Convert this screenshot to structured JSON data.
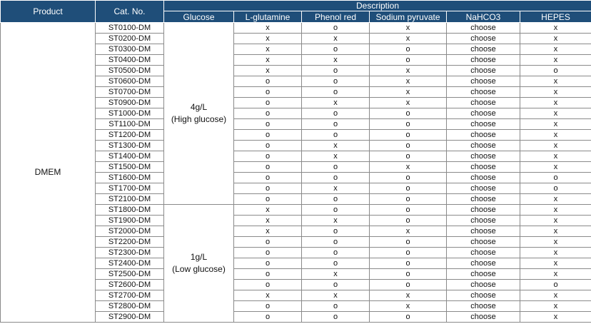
{
  "headers": {
    "product": "Product",
    "cat_no": "Cat. No.",
    "description": "Description",
    "columns": [
      "Glucose",
      "L-glutamine",
      "Phenol red",
      "Sodium pyruvate",
      "NaHCO3",
      "HEPES"
    ]
  },
  "product": "DMEM",
  "groups": [
    {
      "glucose_value": "4g/L",
      "glucose_note": "(High glucose)",
      "rows": [
        [
          "ST0100-DM",
          "x",
          "o",
          "x",
          "choose",
          "x"
        ],
        [
          "ST0200-DM",
          "x",
          "x",
          "x",
          "choose",
          "x"
        ],
        [
          "ST0300-DM",
          "x",
          "o",
          "o",
          "choose",
          "x"
        ],
        [
          "ST0400-DM",
          "x",
          "x",
          "o",
          "choose",
          "x"
        ],
        [
          "ST0500-DM",
          "x",
          "o",
          "x",
          "choose",
          "o"
        ],
        [
          "ST0600-DM",
          "o",
          "o",
          "x",
          "choose",
          "x"
        ],
        [
          "ST0700-DM",
          "o",
          "o",
          "x",
          "choose",
          "x"
        ],
        [
          "ST0900-DM",
          "o",
          "x",
          "x",
          "choose",
          "x"
        ],
        [
          "ST1000-DM",
          "o",
          "o",
          "o",
          "choose",
          "x"
        ],
        [
          "ST1100-DM",
          "o",
          "o",
          "o",
          "choose",
          "x"
        ],
        [
          "ST1200-DM",
          "o",
          "o",
          "o",
          "choose",
          "x"
        ],
        [
          "ST1300-DM",
          "o",
          "x",
          "o",
          "choose",
          "x"
        ],
        [
          "ST1400-DM",
          "o",
          "x",
          "o",
          "choose",
          "x"
        ],
        [
          "ST1500-DM",
          "o",
          "o",
          "x",
          "choose",
          "x"
        ],
        [
          "ST1600-DM",
          "o",
          "o",
          "o",
          "choose",
          "o"
        ],
        [
          "ST1700-DM",
          "o",
          "x",
          "o",
          "choose",
          "o"
        ],
        [
          "ST2100-DM",
          "o",
          "o",
          "o",
          "choose",
          "x"
        ]
      ]
    },
    {
      "glucose_value": "1g/L",
      "glucose_note": "(Low glucose)",
      "rows": [
        [
          "ST1800-DM",
          "x",
          "o",
          "o",
          "choose",
          "x"
        ],
        [
          "ST1900-DM",
          "x",
          "x",
          "o",
          "choose",
          "x"
        ],
        [
          "ST2000-DM",
          "x",
          "o",
          "x",
          "choose",
          "x"
        ],
        [
          "ST2200-DM",
          "o",
          "o",
          "o",
          "choose",
          "x"
        ],
        [
          "ST2300-DM",
          "o",
          "o",
          "o",
          "choose",
          "x"
        ],
        [
          "ST2400-DM",
          "o",
          "o",
          "o",
          "choose",
          "x"
        ],
        [
          "ST2500-DM",
          "o",
          "x",
          "o",
          "choose",
          "x"
        ],
        [
          "ST2600-DM",
          "o",
          "o",
          "o",
          "choose",
          "o"
        ],
        [
          "ST2700-DM",
          "x",
          "x",
          "x",
          "choose",
          "x"
        ],
        [
          "ST2800-DM",
          "o",
          "o",
          "x",
          "choose",
          "x"
        ],
        [
          "ST2900-DM",
          "o",
          "o",
          "o",
          "choose",
          "x"
        ]
      ]
    }
  ],
  "colors": {
    "header_bg": "#1f4e79",
    "header_text": "#ffffff",
    "grid": "#8a8a8a"
  }
}
